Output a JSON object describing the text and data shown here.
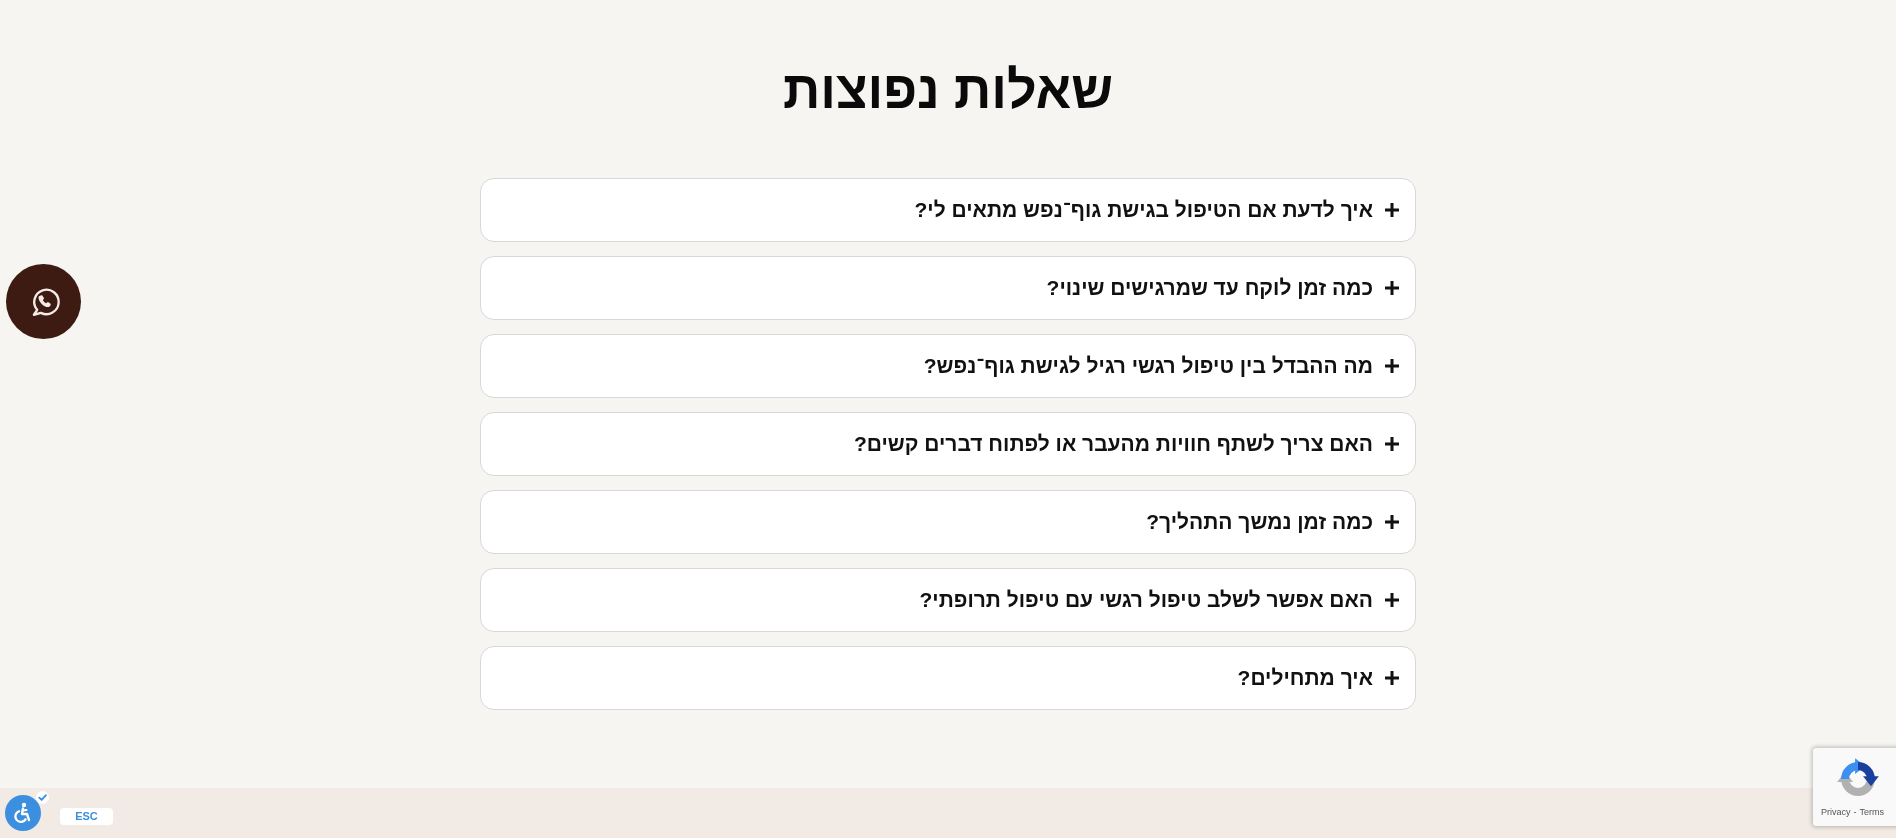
{
  "heading": "שאלות נפוצות",
  "faq": [
    {
      "question": "איך לדעת אם הטיפול בגישת גוף־נפש מתאים לי?",
      "expanded": false
    },
    {
      "question": "כמה זמן לוקח עד שמרגישים שינוי?",
      "expanded": false
    },
    {
      "question": "מה ההבדל בין טיפול רגשי רגיל לגישת גוף־נפש?",
      "expanded": false
    },
    {
      "question": "האם צריך לשתף חוויות מהעבר או לפתוח דברים קשים?",
      "expanded": false
    },
    {
      "question": "כמה זמן נמשך התהליך?",
      "expanded": false
    },
    {
      "question": "האם אפשר לשלב טיפול רגשי עם טיפול תרופתי?",
      "expanded": false
    },
    {
      "question": "איך מתחילים?",
      "expanded": false
    }
  ],
  "accessibility": {
    "shortcut": "ESC"
  },
  "captcha": {
    "privacy_link": "Privacy",
    "separator": "-",
    "terms_link": "Terms"
  }
}
